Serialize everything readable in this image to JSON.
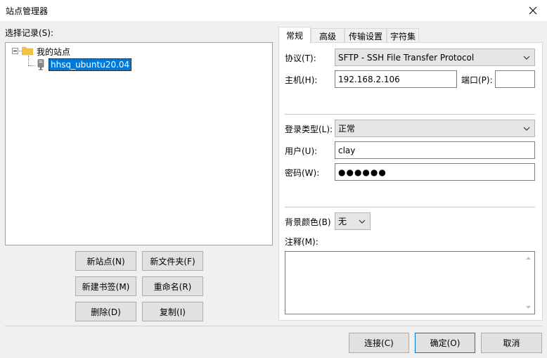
{
  "window": {
    "title": "站点管理器"
  },
  "left": {
    "select_label": "选择记录(S):",
    "tree": {
      "root_label": "我的站点",
      "site_label": "hhsq_ubuntu20.04"
    },
    "buttons": {
      "new_site": "新站点(N)",
      "new_folder": "新文件夹(F)",
      "new_bookmark": "新建书签(M)",
      "rename": "重命名(R)",
      "delete": "删除(D)",
      "copy": "复制(I)"
    }
  },
  "tabs": [
    "常规",
    "高级",
    "传输设置",
    "字符集"
  ],
  "general": {
    "protocol_label": "协议(T):",
    "protocol_value": "SFTP - SSH File Transfer Protocol",
    "host_label": "主机(H):",
    "host_value": "192.168.2.106",
    "port_label": "端口(P):",
    "port_value": "",
    "logon_type_label": "登录类型(L):",
    "logon_type_value": "正常",
    "user_label": "用户(U):",
    "user_value": "clay",
    "password_label": "密码(W):",
    "password_value": "●●●●●●",
    "bg_color_label": "背景颜色(B)",
    "bg_color_value": "无",
    "comments_label": "注释(M):",
    "comments_value": ""
  },
  "footer": {
    "connect": "连接(C)",
    "ok": "确定(O)",
    "cancel": "取消"
  },
  "colors": {
    "selection": "#0078d7",
    "folder": "#f4c242"
  }
}
